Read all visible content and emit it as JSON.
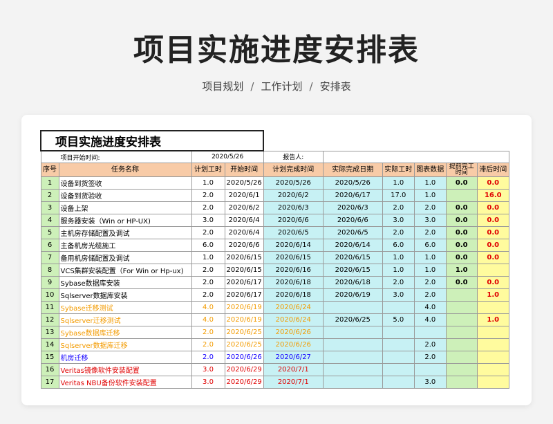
{
  "page": {
    "title": "项目实施进度安排表",
    "breadcrumb": [
      "项目规划",
      "工作计划",
      "安排表"
    ],
    "breadcrumb_sep": "/"
  },
  "sheet": {
    "title": "项目实施进度安排表",
    "start_label": "项目开始时间:",
    "start_value": "2020/5/26",
    "reporter_label": "报告人:",
    "headers": [
      "序号",
      "任务名称",
      "计划工时",
      "开始时间",
      "计划完成时间",
      "实际完成日期",
      "实际工时",
      "图表数据",
      "提前完工时间",
      "滞后时间"
    ],
    "rows": [
      {
        "no": "1",
        "task": "设备到货签收",
        "plan_hours": "1.0",
        "start": "2020/5/26",
        "plan_end": "2020/5/26",
        "actual_end": "2020/5/26",
        "actual_hours": "1.0",
        "chart": "1.0",
        "early": "0.0",
        "late": "0.0",
        "color": "black"
      },
      {
        "no": "2",
        "task": "设备到货验收",
        "plan_hours": "2.0",
        "start": "2020/6/1",
        "plan_end": "2020/6/2",
        "actual_end": "2020/6/17",
        "actual_hours": "17.0",
        "chart": "1.0",
        "early": "",
        "late": "16.0",
        "color": "black"
      },
      {
        "no": "3",
        "task": "设备上架",
        "plan_hours": "2.0",
        "start": "2020/6/2",
        "plan_end": "2020/6/3",
        "actual_end": "2020/6/3",
        "actual_hours": "2.0",
        "chart": "2.0",
        "early": "0.0",
        "late": "0.0",
        "color": "black"
      },
      {
        "no": "4",
        "task": "服务器安装（Win or HP-UX)",
        "plan_hours": "3.0",
        "start": "2020/6/4",
        "plan_end": "2020/6/6",
        "actual_end": "2020/6/6",
        "actual_hours": "3.0",
        "chart": "3.0",
        "early": "0.0",
        "late": "0.0",
        "color": "black"
      },
      {
        "no": "5",
        "task": "主机房存储配置及调试",
        "plan_hours": "2.0",
        "start": "2020/6/4",
        "plan_end": "2020/6/5",
        "actual_end": "2020/6/5",
        "actual_hours": "2.0",
        "chart": "2.0",
        "early": "0.0",
        "late": "0.0",
        "color": "black"
      },
      {
        "no": "6",
        "task": "主备机房光缆施工",
        "plan_hours": "6.0",
        "start": "2020/6/6",
        "plan_end": "2020/6/14",
        "actual_end": "2020/6/14",
        "actual_hours": "6.0",
        "chart": "6.0",
        "early": "0.0",
        "late": "0.0",
        "color": "black"
      },
      {
        "no": "7",
        "task": "备用机房储配置及调试",
        "plan_hours": "1.0",
        "start": "2020/6/15",
        "plan_end": "2020/6/15",
        "actual_end": "2020/6/15",
        "actual_hours": "1.0",
        "chart": "1.0",
        "early": "0.0",
        "late": "0.0",
        "color": "black"
      },
      {
        "no": "8",
        "task": "VCS集群安装配置（For Win or Hp-ux)",
        "plan_hours": "2.0",
        "start": "2020/6/15",
        "plan_end": "2020/6/16",
        "actual_end": "2020/6/15",
        "actual_hours": "1.0",
        "chart": "1.0",
        "early": "1.0",
        "late": "",
        "color": "black"
      },
      {
        "no": "9",
        "task": "Sybase数据库安装",
        "plan_hours": "2.0",
        "start": "2020/6/17",
        "plan_end": "2020/6/18",
        "actual_end": "2020/6/18",
        "actual_hours": "2.0",
        "chart": "2.0",
        "early": "0.0",
        "late": "0.0",
        "color": "black"
      },
      {
        "no": "10",
        "task": "Sqlserver数据库安装",
        "plan_hours": "2.0",
        "start": "2020/6/17",
        "plan_end": "2020/6/18",
        "actual_end": "2020/6/19",
        "actual_hours": "3.0",
        "chart": "2.0",
        "early": "",
        "late": "1.0",
        "color": "black"
      },
      {
        "no": "11",
        "task": "Sybase迁移测试",
        "plan_hours": "4.0",
        "start": "2020/6/19",
        "plan_end": "2020/6/24",
        "actual_end": "",
        "actual_hours": "",
        "chart": "4.0",
        "early": "",
        "late": "",
        "color": "orange"
      },
      {
        "no": "12",
        "task": "Sqlserver迁移测试",
        "plan_hours": "4.0",
        "start": "2020/6/19",
        "plan_end": "2020/6/24",
        "actual_end": "2020/6/25",
        "actual_hours": "5.0",
        "chart": "4.0",
        "early": "",
        "late": "1.0",
        "color": "orange"
      },
      {
        "no": "13",
        "task": "Sybase数据库迁移",
        "plan_hours": "2.0",
        "start": "2020/6/25",
        "plan_end": "2020/6/26",
        "actual_end": "",
        "actual_hours": "",
        "chart": "",
        "early": "",
        "late": "",
        "color": "orange"
      },
      {
        "no": "14",
        "task": "Sqlserver数据库迁移",
        "plan_hours": "2.0",
        "start": "2020/6/25",
        "plan_end": "2020/6/26",
        "actual_end": "",
        "actual_hours": "",
        "chart": "2.0",
        "early": "",
        "late": "",
        "color": "orange"
      },
      {
        "no": "15",
        "task": "机房迁移",
        "plan_hours": "2.0",
        "start": "2020/6/26",
        "plan_end": "2020/6/27",
        "actual_end": "",
        "actual_hours": "",
        "chart": "2.0",
        "early": "",
        "late": "",
        "color": "blue"
      },
      {
        "no": "16",
        "task": "Veritas镜像软件安装配置",
        "plan_hours": "3.0",
        "start": "2020/6/29",
        "plan_end": "2020/7/1",
        "actual_end": "",
        "actual_hours": "",
        "chart": "",
        "early": "",
        "late": "",
        "color": "red"
      },
      {
        "no": "17",
        "task": "Veritas NBU备份软件安装配置",
        "plan_hours": "3.0",
        "start": "2020/6/29",
        "plan_end": "2020/7/1",
        "actual_end": "",
        "actual_hours": "",
        "chart": "3.0",
        "early": "",
        "late": "",
        "color": "red"
      }
    ]
  }
}
